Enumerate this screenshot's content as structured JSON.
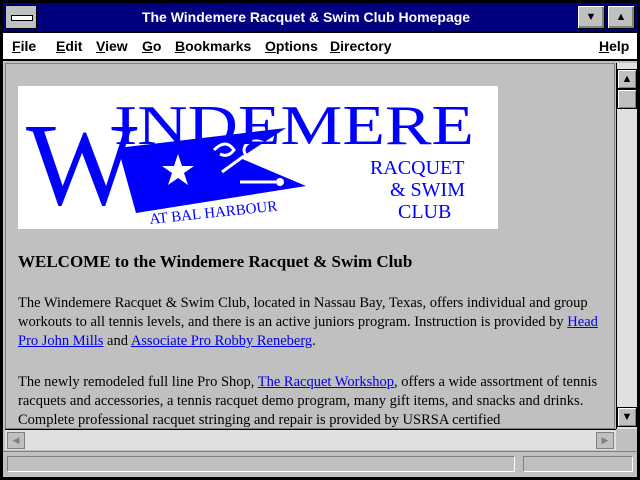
{
  "window": {
    "title": "The Windemere Racquet & Swim Club Homepage"
  },
  "menu": {
    "items": [
      {
        "label": "File",
        "u": "F",
        "rest": "ile"
      },
      {
        "label": "Edit",
        "u": "E",
        "rest": "dit"
      },
      {
        "label": "View",
        "u": "V",
        "rest": "iew"
      },
      {
        "label": "Go",
        "u": "G",
        "rest": "o"
      },
      {
        "label": "Bookmarks",
        "u": "B",
        "rest": "ookmarks"
      },
      {
        "label": "Options",
        "u": "O",
        "rest": "ptions"
      },
      {
        "label": "Directory",
        "u": "D",
        "rest": "irectory"
      },
      {
        "label": "Help",
        "u": "H",
        "rest": "elp"
      }
    ]
  },
  "logo": {
    "word": "WINDEMERE",
    "sub1": "RACQUET",
    "sub2": "& SWIM",
    "sub3": "CLUB",
    "arc": "AT BAL HARBOUR",
    "color": "#0000ff"
  },
  "page": {
    "heading": "WELCOME to the Windemere Racquet & Swim Club",
    "p1_a": "The Windemere Racquet & Swim Club, located in Nassau Bay, Texas, offers individual and group workouts to all tennis levels, and there is an active juniors program. Instruction is provided by ",
    "p1_link1": "Head Pro John Mills",
    "p1_b": " and ",
    "p1_link2": "Associate Pro Robby Reneberg",
    "p1_c": ".",
    "p2_a": "The newly remodeled full line Pro Shop, ",
    "p2_link": "The Racquet Workshop",
    "p2_b": ", offers a wide assortment of tennis racquets and accessories, a tennis racquet demo program, many gift items, and snacks and drinks. Complete professional racquet stringing and repair is provided by USRSA certified"
  },
  "scrollbar": {
    "up_icon": "arrow-up-icon",
    "down_icon": "arrow-down-icon"
  }
}
